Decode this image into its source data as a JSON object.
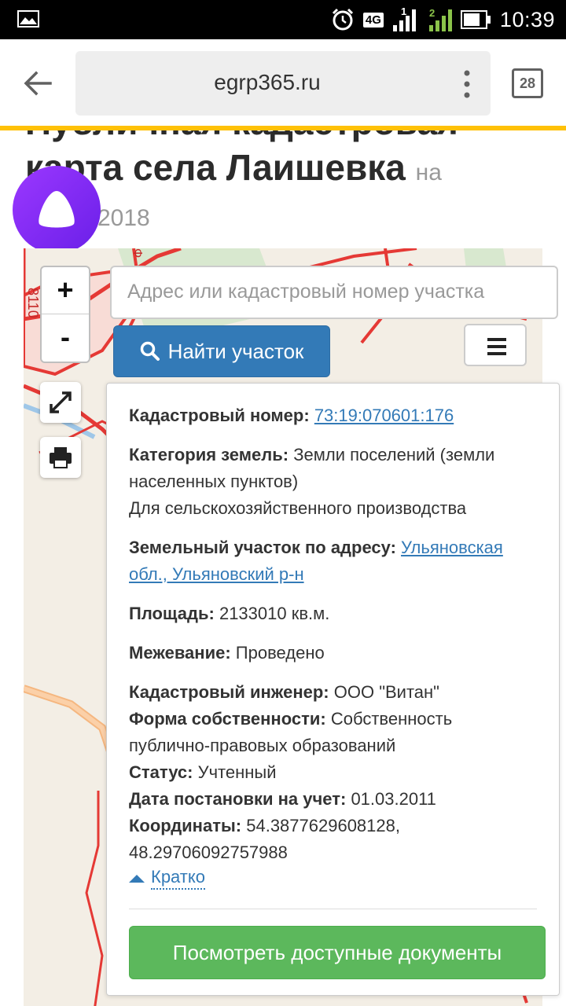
{
  "status_bar": {
    "time": "10:39",
    "network": "4G",
    "sim1": "1",
    "sim2": "2"
  },
  "browser": {
    "url": "egrp365.ru",
    "tabs_count": "28"
  },
  "page": {
    "title_line1": "Публичная кадастровая",
    "title_line2": "карта села Лаишевка",
    "title_suffix": "на",
    "title_line3": "2018"
  },
  "map": {
    "zoom_in": "+",
    "zoom_out": "-",
    "search_placeholder": "Адрес или кадастровый номер участка",
    "find_button": "Найти участок",
    "map_label": "8110"
  },
  "parcel": {
    "cadastral_label": "Кадастровый номер:",
    "cadastral_value": "73:19:070601:176",
    "category_label": "Категория земель:",
    "category_value": "Земли поселений (земли населенных пунктов)",
    "use_value": "Для сельскохозяйственного производства",
    "address_label": "Земельный участок по адресу:",
    "address_value": "Ульяновская обл., Ульяновский р-н",
    "area_label": "Площадь:",
    "area_value": "2133010 кв.м.",
    "survey_label": "Межевание:",
    "survey_value": "Проведено",
    "engineer_label": "Кадастровый инженер:",
    "engineer_value": "ООО \"Витан\"",
    "ownership_label": "Форма собственности:",
    "ownership_value": "Собственность публично-правовых образований",
    "status_label": "Статус:",
    "status_value": "Учтенный",
    "date_label": "Дата постановки на учет:",
    "date_value": "01.03.2011",
    "coords_label": "Координаты:",
    "coords_value": "54.3877629608128, 48.29706092757988",
    "brief_link": "Кратко",
    "docs_button": "Посмотреть доступные документы"
  },
  "colors": {
    "accent_yellow": "#ffc107",
    "primary_blue": "#337ab7",
    "success_green": "#5cb85c",
    "alice_purple": "#7b2ff7",
    "map_border_red": "#e53935"
  }
}
